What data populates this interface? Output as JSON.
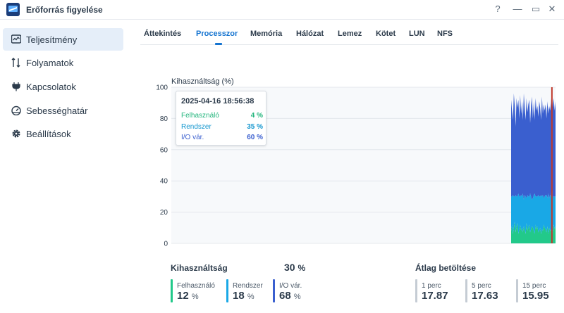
{
  "window": {
    "title": "Erőforrás figyelése",
    "help_label": "?",
    "minimize_label": "—",
    "maximize_label": "▭",
    "close_label": "✕"
  },
  "sidebar": {
    "items": [
      {
        "label": "Teljesítmény",
        "icon": "performance-icon",
        "active": true
      },
      {
        "label": "Folyamatok",
        "icon": "processes-icon",
        "active": false
      },
      {
        "label": "Kapcsolatok",
        "icon": "plug-icon",
        "active": false
      },
      {
        "label": "Sebességhatár",
        "icon": "speedometer-icon",
        "active": false
      },
      {
        "label": "Beállítások",
        "icon": "gear-icon",
        "active": false
      }
    ]
  },
  "tabs": [
    {
      "label": "Áttekintés",
      "active": false
    },
    {
      "label": "Processzor",
      "active": true
    },
    {
      "label": "Memória",
      "active": false
    },
    {
      "label": "Hálózat",
      "active": false
    },
    {
      "label": "Lemez",
      "active": false
    },
    {
      "label": "Kötet",
      "active": false
    },
    {
      "label": "LUN",
      "active": false
    },
    {
      "label": "NFS",
      "active": false
    }
  ],
  "tooltip": {
    "timestamp": "2025-04-16 18:56:38",
    "rows": [
      {
        "name": "Felhasználó",
        "value": "4 %"
      },
      {
        "name": "Rendszer",
        "value": "35 %"
      },
      {
        "name": "I/O vár.",
        "value": "60 %"
      }
    ]
  },
  "colors": {
    "user": "#22c98a",
    "system": "#19a8e6",
    "io_wait": "#3a5fcf",
    "accent": "#1574d0",
    "cursor": "#c0392b"
  },
  "chart_data": {
    "type": "area",
    "ylabel": "Kihasználtság (%)",
    "ylim": [
      0,
      100
    ],
    "yticks": [
      0,
      20,
      40,
      60,
      80,
      100
    ],
    "stacked": true,
    "grid": true,
    "series": [
      {
        "name": "Felhasználó",
        "color": "#22c98a",
        "values": [
          8,
          12,
          6,
          10,
          14,
          7,
          11,
          13,
          6,
          9,
          12,
          8,
          10,
          7,
          11,
          9,
          6,
          13,
          8,
          10,
          12,
          7,
          9,
          11,
          10,
          8,
          6,
          12,
          9,
          11,
          7,
          8,
          10,
          6,
          9,
          8,
          12,
          10,
          9,
          7,
          11,
          6,
          10,
          8,
          9,
          4,
          8,
          12,
          9,
          11
        ]
      },
      {
        "name": "Rendszer",
        "color": "#19a8e6",
        "values": [
          22,
          18,
          25,
          20,
          16,
          24,
          19,
          17,
          26,
          21,
          18,
          23,
          20,
          25,
          17,
          22,
          24,
          16,
          23,
          20,
          18,
          25,
          21,
          17,
          19,
          23,
          26,
          18,
          21,
          19,
          24,
          22,
          20,
          25,
          21,
          23,
          17,
          20,
          22,
          24,
          18,
          26,
          19,
          23,
          21,
          35,
          22,
          18,
          21,
          19
        ]
      },
      {
        "name": "I/O vár.",
        "color": "#3a5fcf",
        "values": [
          62,
          55,
          48,
          66,
          58,
          44,
          63,
          57,
          60,
          50,
          65,
          52,
          61,
          47,
          68,
          56,
          49,
          64,
          53,
          59,
          62,
          45,
          58,
          66,
          51,
          60,
          47,
          63,
          55,
          58,
          50,
          61,
          57,
          48,
          64,
          52,
          60,
          55,
          58,
          49,
          62,
          51,
          59,
          54,
          60,
          60,
          57,
          63,
          55,
          61
        ]
      }
    ],
    "cursor_index": 45
  },
  "summary": {
    "title": "Kihasználtság",
    "total_value": "30",
    "total_unit": "%",
    "stats": [
      {
        "name": "Felhasználó",
        "value": "12",
        "unit": "%"
      },
      {
        "name": "Rendszer",
        "value": "18",
        "unit": "%"
      },
      {
        "name": "I/O vár.",
        "value": "68",
        "unit": "%"
      }
    ]
  },
  "load": {
    "title": "Átlag betöltése",
    "stats": [
      {
        "name": "1 perc",
        "value": "17.87"
      },
      {
        "name": "5 perc",
        "value": "17.63"
      },
      {
        "name": "15 perc",
        "value": "15.95"
      }
    ]
  }
}
